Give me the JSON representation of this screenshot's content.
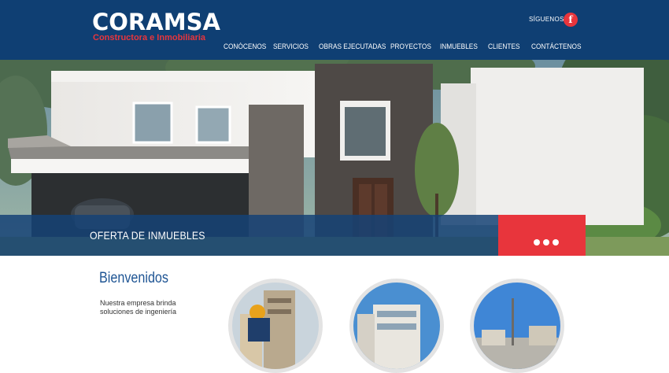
{
  "header": {
    "logo_main": "CORAMSA",
    "logo_sub": "Constructora e Inmobiliaria",
    "follow_label": "SÍGUENOS",
    "facebook_glyph": "f",
    "facebook_icon": "facebook-icon",
    "bg_color": "#0f3f73",
    "accent_color": "#e8353c"
  },
  "nav": {
    "items": [
      {
        "label": "CONÓCENOS"
      },
      {
        "label": "SERVICIOS"
      },
      {
        "label": "OBRAS EJECUTADAS"
      },
      {
        "label": "PROYECTOS"
      },
      {
        "label": "INMUEBLES"
      },
      {
        "label": "CLIENTES"
      },
      {
        "label": "CONTÁCTENOS"
      }
    ]
  },
  "hero": {
    "caption": "OFERTA DE INMUEBLES",
    "slide_count": 3,
    "active_slide": 1
  },
  "welcome": {
    "title": "Bienvenidos",
    "text": "Nuestra empresa brinda soluciones de ingeniería"
  }
}
